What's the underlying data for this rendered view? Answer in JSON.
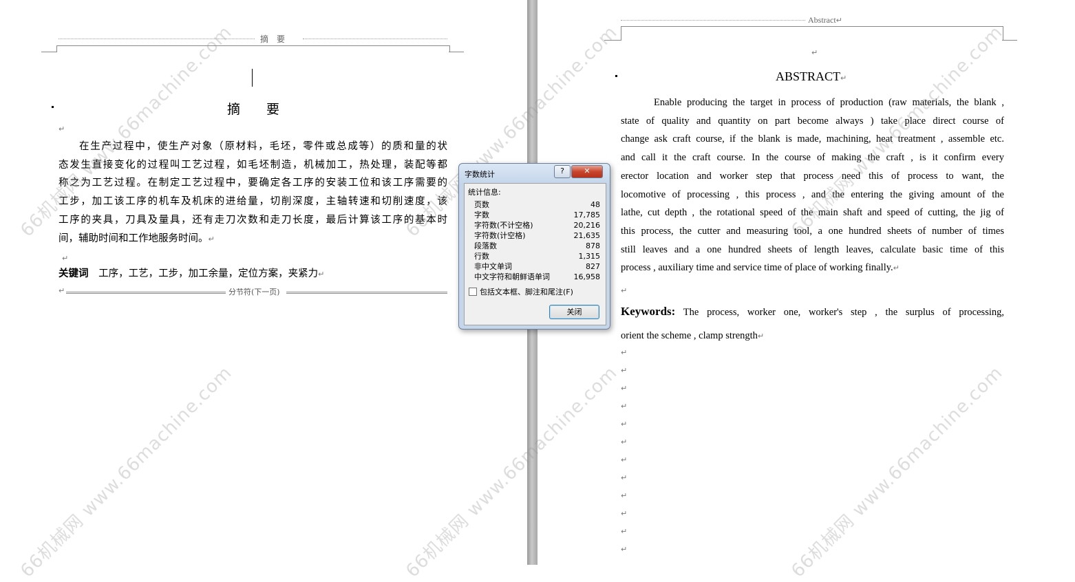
{
  "left_page": {
    "header_text": "摘　要",
    "title": "摘　　要",
    "para_lines": [
      "在生产过程中，使生产对象（原材料，毛坯，零件或总成等）的质和量的状",
      "态发生直接变化的过程叫工艺过程，如毛坯制造，机械加工，热处理，装配等都",
      "称之为工艺过程。在制定工艺过程中，要确定各工序的安装工位和该工序需要的",
      "工步，加工该工序的机车及机床的进给量，切削深度，主轴转速和切削速度，该",
      "工序的夹具，刀具及量具，还有走刀次数和走刀长度，最后计算该工序的基本时"
    ],
    "para_last_line": "间，辅助时间和工作地服务时间。",
    "keywords_label": "关键词",
    "keywords_text": "工序，工艺，工步，加工余量，定位方案，夹紧力",
    "section_break": "分节符(下一页)"
  },
  "right_page": {
    "header_text": "Abstract",
    "title": "ABSTRACT",
    "para_lines": [
      "Enable producing the target in process of production (raw materials, the blank ,",
      "state of quality and quantity on part become always ) take place direct course of",
      "change ask craft course, if the blank is made, machining, heat treatment , assemble etc.",
      "and call it the craft course. In the course of making the craft , is it confirm every",
      "erector location and worker step that process need this of process to want, the",
      "locomotive of processing , this process , and the entering the giving amount of the",
      "lathe, cut depth , the rotational speed of the main shaft and speed of cutting, the jig of",
      "this process, the cutter and measuring tool, a one hundred sheets of number of times",
      "still leaves and a one hundred sheets of length leaves, calculate basic time of this"
    ],
    "para_last_line": "process , auxiliary time and service time of place of working finally.",
    "keywords_label": "Keywords:",
    "keywords_line1": "The process, worker one, worker's step , the surplus of processing,",
    "keywords_line2": "orient the scheme , clamp strength"
  },
  "dialog": {
    "title": "字数统计",
    "help_label": "?",
    "close_x": "✕",
    "group_label": "统计信息:",
    "stats": [
      {
        "label": "页数",
        "value": "48"
      },
      {
        "label": "字数",
        "value": "17,785"
      },
      {
        "label": "字符数(不计空格)",
        "value": "20,216"
      },
      {
        "label": "字符数(计空格)",
        "value": "21,635"
      },
      {
        "label": "段落数",
        "value": "878"
      },
      {
        "label": "行数",
        "value": "1,315"
      },
      {
        "label": "非中文单词",
        "value": "827"
      },
      {
        "label": "中文字符和朝鲜语单词",
        "value": "16,958"
      }
    ],
    "checkbox_label": "包括文本框、脚注和尾注(F)",
    "checkbox_checked": false,
    "close_button": "关闭"
  },
  "watermark": {
    "text": "66机械网 www.66machine.com"
  },
  "marks": {
    "paragraph": "↵"
  }
}
